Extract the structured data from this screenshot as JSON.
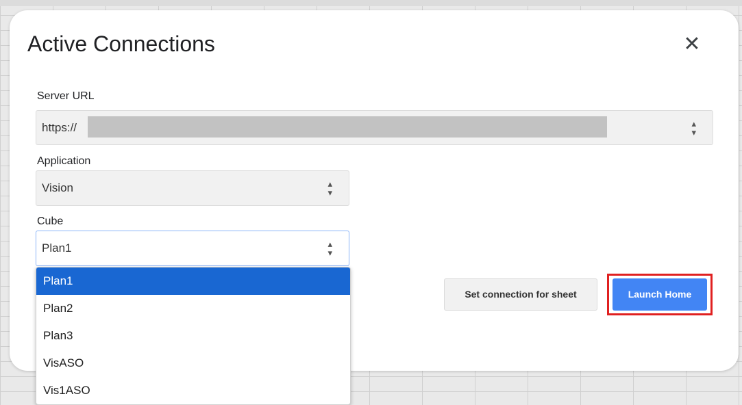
{
  "dialog": {
    "title": "Active Connections",
    "close_icon": "close-icon"
  },
  "server_url": {
    "label": "Server URL",
    "value": "https://"
  },
  "application": {
    "label": "Application",
    "value": "Vision"
  },
  "cube": {
    "label": "Cube",
    "value": "Plan1",
    "options": [
      "Plan1",
      "Plan2",
      "Plan3",
      "VisASO",
      "Vis1ASO"
    ],
    "selected_option": "Plan1"
  },
  "buttons": {
    "set_connection": "Set connection for sheet",
    "launch_home": "Launch Home"
  },
  "colors": {
    "primary_button": "#4285f4",
    "selected_option": "#1967d2",
    "highlight_border": "#e02020"
  }
}
